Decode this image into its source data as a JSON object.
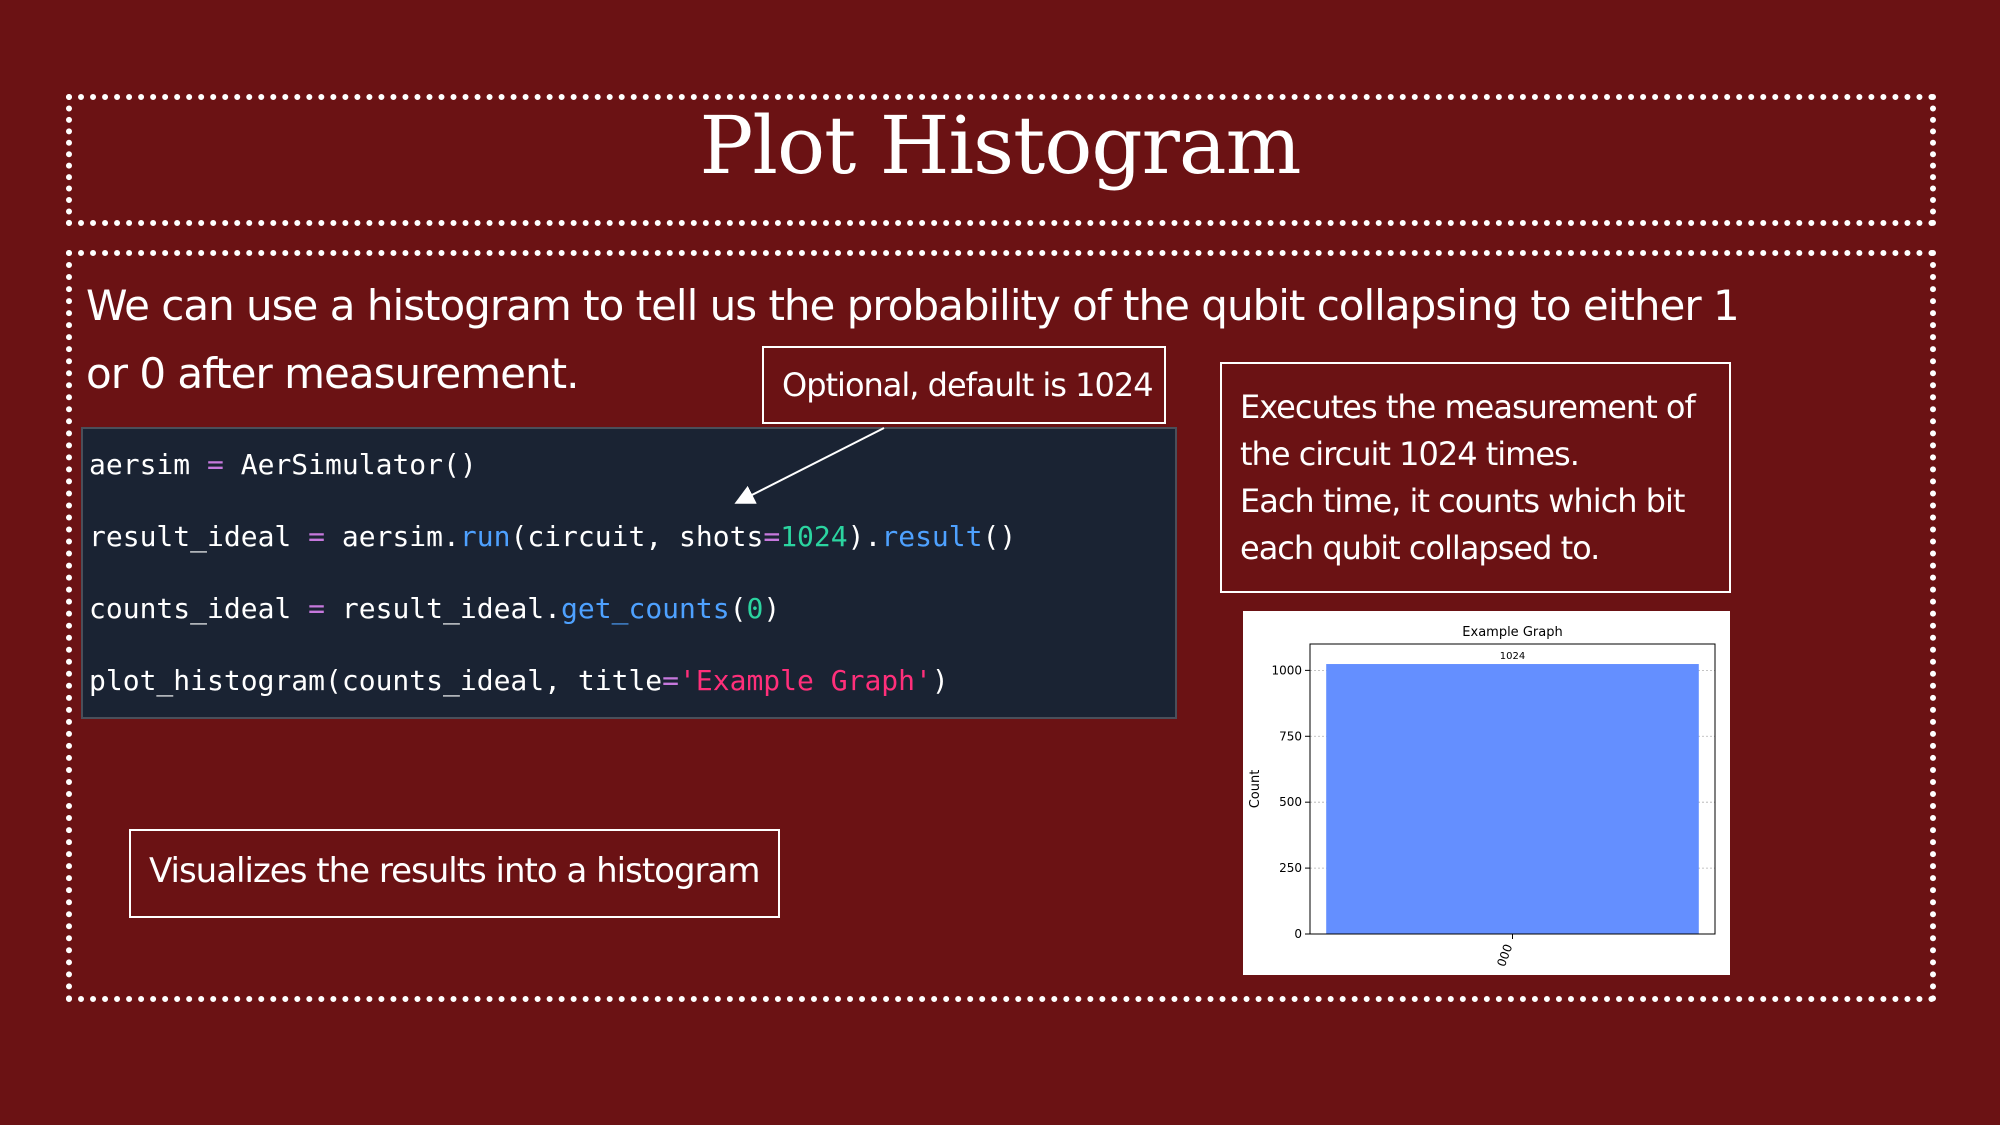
{
  "slide": {
    "title": "Plot Histogram",
    "intro": "We can use a histogram to tell us the probability of the qubit collapsing to either 1 or 0 after measurement."
  },
  "code": {
    "line1": {
      "var": "aersim",
      "op": " = ",
      "call": "AerSimulator()"
    },
    "line2": {
      "var": "result_ideal",
      "op": " = ",
      "obj": "aersim.",
      "fn": "run",
      "args_open": "(circuit, shots",
      "eq": "=",
      "num": "1024",
      "close": ").",
      "fn2": "result",
      "end": "()"
    },
    "line3": {
      "var": "counts_ideal",
      "op": " = ",
      "obj": "result_ideal.",
      "fn": "get_counts",
      "open": "(",
      "num": "0",
      "close": ")"
    },
    "line4": {
      "call": "plot_histogram(counts_ideal, title",
      "eq": "=",
      "str": "'Example Graph'",
      "close": ")"
    }
  },
  "callouts": {
    "shots": "Optional, default is 1024",
    "execute": "Executes the measurement of the circuit 1024 times.\nEach time, it counts which bit each qubit collapsed to.",
    "visualize": "Visualizes the results into a histogram"
  },
  "chart_data": {
    "type": "bar",
    "title": "Example Graph",
    "categories": [
      "000"
    ],
    "values": [
      1024
    ],
    "data_labels": [
      "1024"
    ],
    "ylabel": "Count",
    "xlabel": "",
    "ylim": [
      0,
      1100
    ],
    "yticks": [
      0,
      250,
      500,
      750,
      1000
    ],
    "grid": true,
    "bar_color": "#648fff"
  },
  "colors": {
    "background": "#6b1214",
    "code_background": "#1a2333",
    "operator": "#c678dd",
    "function": "#4ea1ff",
    "number": "#2bd4a0",
    "string": "#ff2f7a"
  }
}
